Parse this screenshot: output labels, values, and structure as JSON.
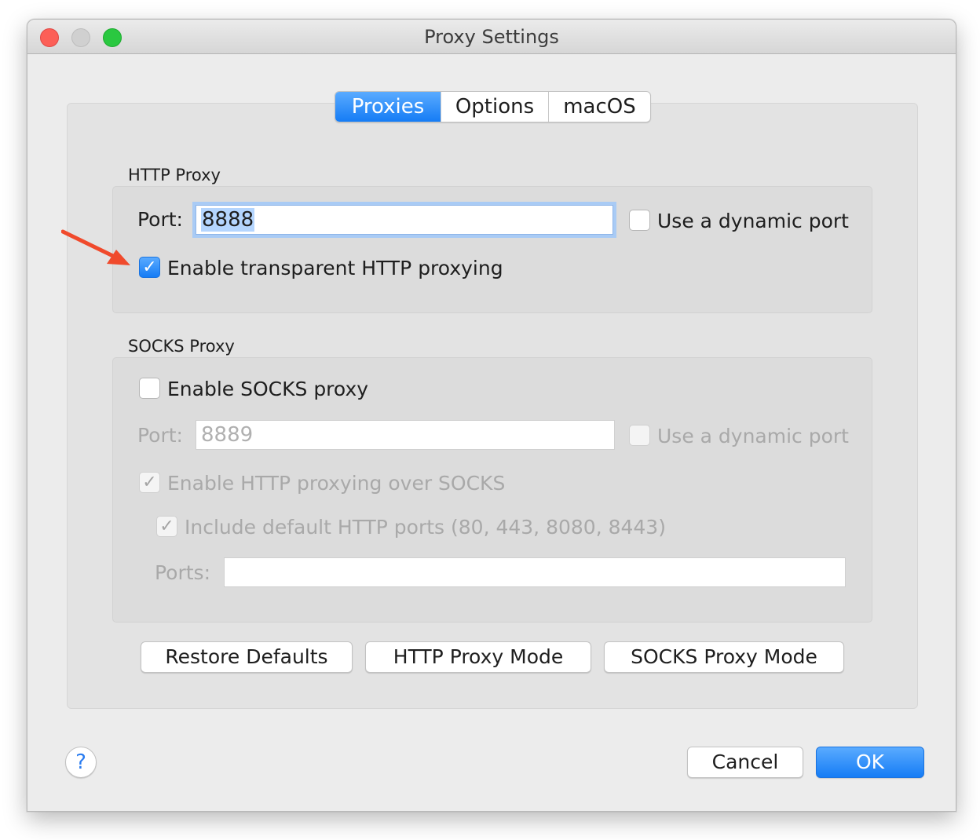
{
  "window": {
    "title": "Proxy Settings"
  },
  "tabs": [
    {
      "label": "Proxies",
      "selected": true
    },
    {
      "label": "Options",
      "selected": false
    },
    {
      "label": "macOS",
      "selected": false
    }
  ],
  "http_proxy": {
    "title": "HTTP Proxy",
    "port_label": "Port:",
    "port_value": "8888",
    "dynamic_port_label": "Use a dynamic port",
    "dynamic_port_checked": false,
    "transparent_label": "Enable transparent HTTP proxying",
    "transparent_checked": true
  },
  "socks_proxy": {
    "title": "SOCKS Proxy",
    "enable_label": "Enable SOCKS proxy",
    "enable_checked": false,
    "port_label": "Port:",
    "port_value": "8889",
    "dynamic_port_label": "Use a dynamic port",
    "http_over_socks_label": "Enable HTTP proxying over SOCKS",
    "include_ports_label": "Include default HTTP ports (80, 443, 8080, 8443)",
    "ports_label": "Ports:",
    "ports_value": ""
  },
  "mode_buttons": {
    "restore": "Restore Defaults",
    "http_mode": "HTTP Proxy Mode",
    "socks_mode": "SOCKS Proxy Mode"
  },
  "footer": {
    "help": "?",
    "cancel": "Cancel",
    "ok": "OK"
  },
  "colors": {
    "accent": "#157cf5",
    "annotation_arrow": "#f04a2c",
    "close": "#fc5f57",
    "maximize": "#2ac840"
  },
  "icons": {
    "check": "✓"
  }
}
